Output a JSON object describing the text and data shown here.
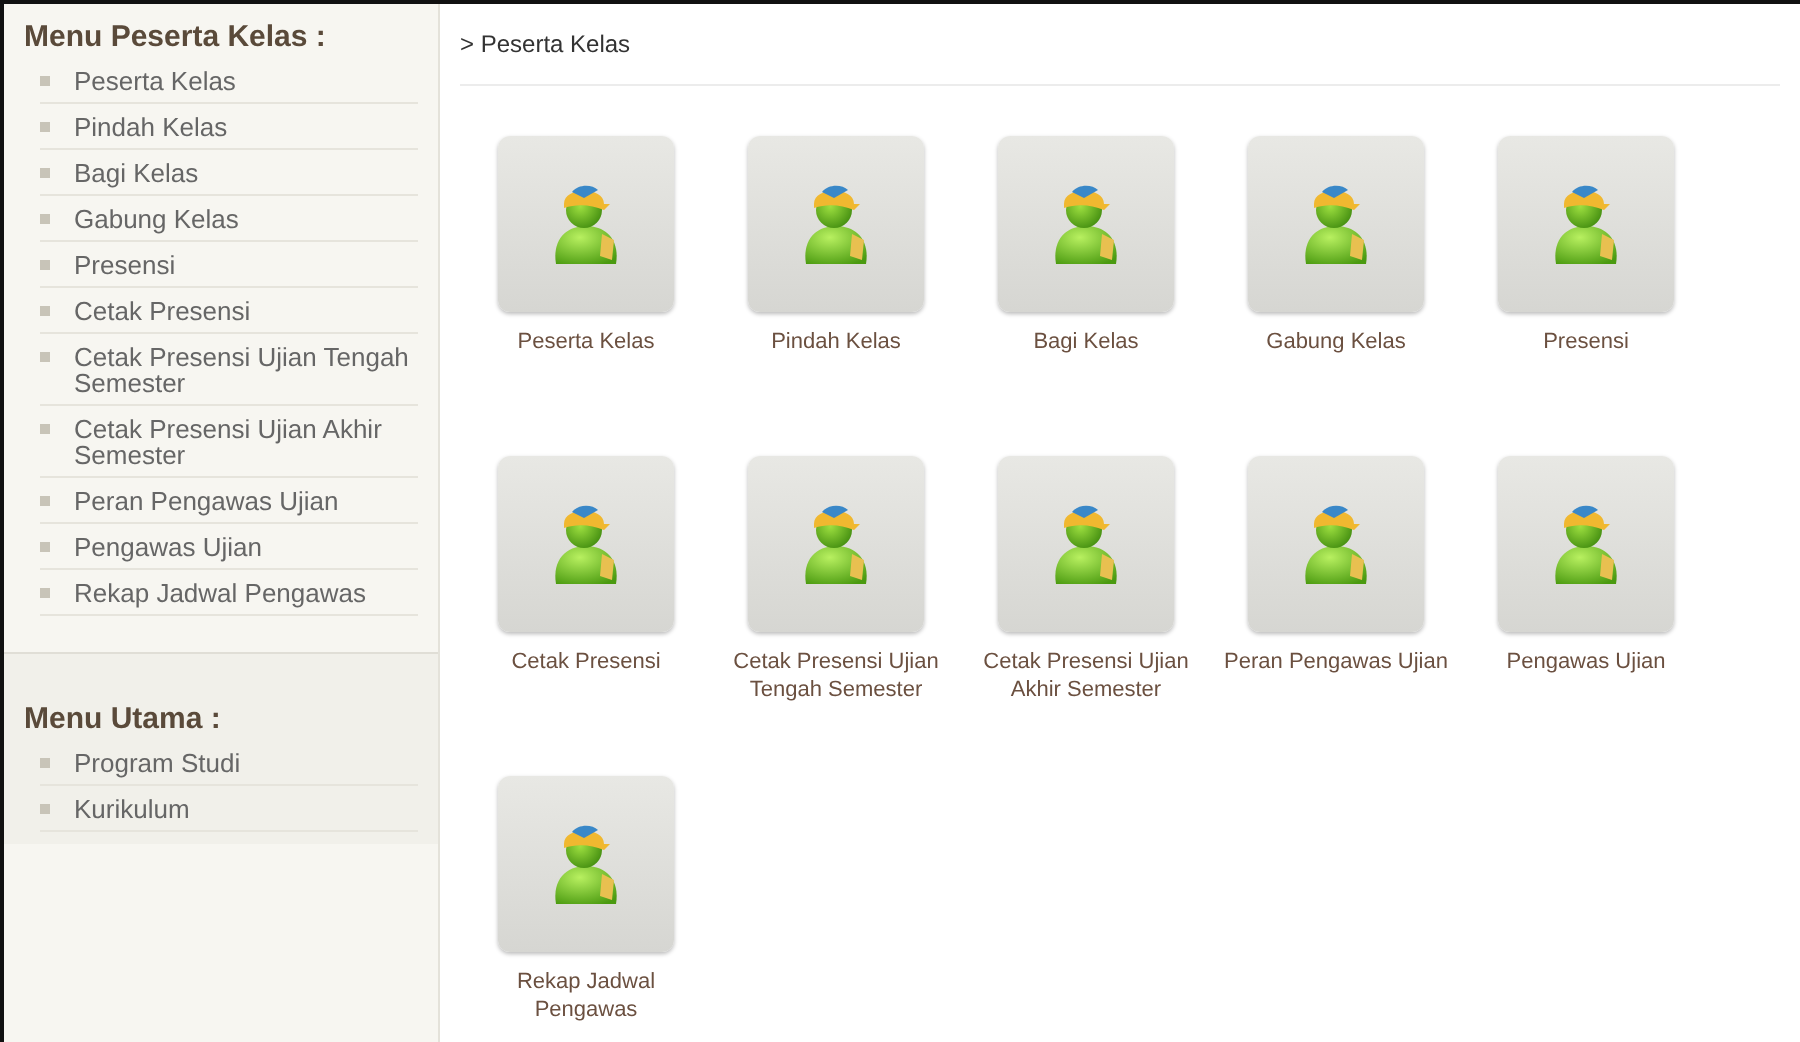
{
  "sidebar": {
    "sections": [
      {
        "title": "Menu Peserta Kelas :",
        "items": [
          "Peserta Kelas",
          "Pindah Kelas",
          "Bagi Kelas",
          "Gabung Kelas",
          "Presensi",
          "Cetak Presensi",
          "Cetak Presensi Ujian Tengah Semester",
          "Cetak Presensi Ujian Akhir Semester",
          "Peran Pengawas Ujian",
          "Pengawas Ujian",
          "Rekap Jadwal Pengawas"
        ]
      },
      {
        "title": "Menu Utama :",
        "items": [
          "Program Studi",
          "Kurikulum"
        ]
      }
    ]
  },
  "breadcrumb": "> Peserta Kelas",
  "tiles": [
    {
      "label": "Peserta Kelas"
    },
    {
      "label": "Pindah Kelas"
    },
    {
      "label": "Bagi Kelas"
    },
    {
      "label": "Gabung Kelas"
    },
    {
      "label": "Presensi"
    },
    {
      "label": "Cetak Presensi"
    },
    {
      "label": "Cetak Presensi Ujian Tengah Semester"
    },
    {
      "label": "Cetak Presensi Ujian Akhir Semester"
    },
    {
      "label": "Peran Pengawas Ujian"
    },
    {
      "label": "Pengawas Ujian"
    },
    {
      "label": "Rekap Jadwal Pengawas"
    }
  ]
}
